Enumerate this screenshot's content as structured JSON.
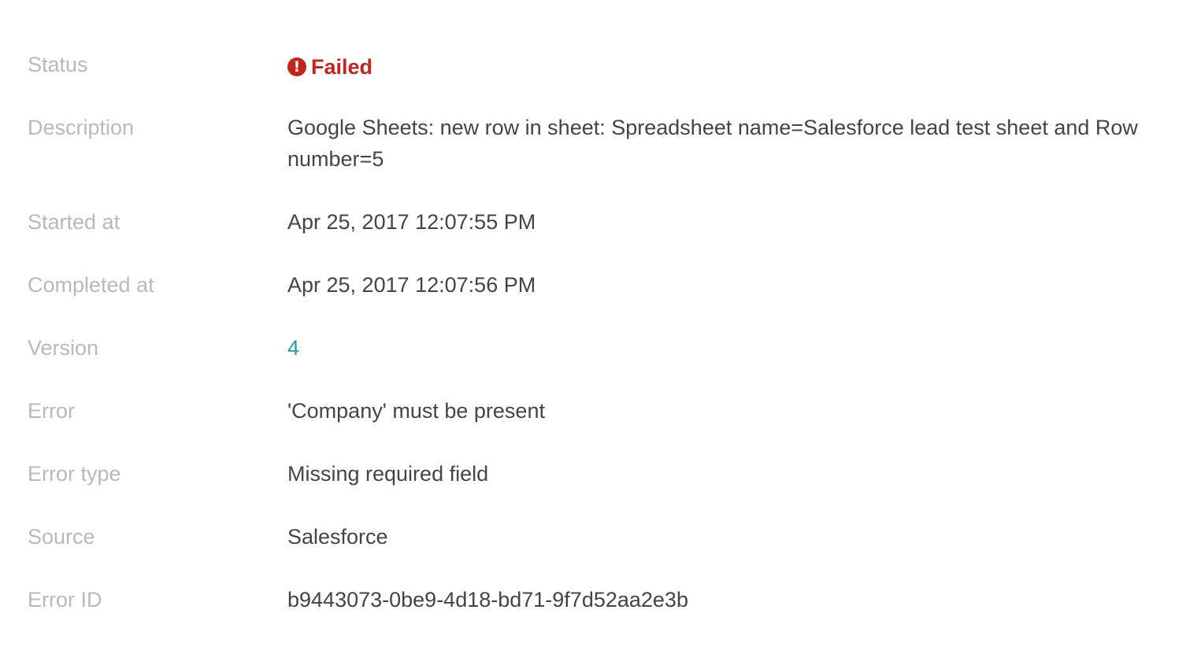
{
  "details": {
    "status": {
      "label": "Status",
      "value": "Failed",
      "icon": "exclamation-circle-icon",
      "color": "#c0271c"
    },
    "description": {
      "label": "Description",
      "value": "Google Sheets: new row in sheet: Spreadsheet name=Salesforce lead test sheet and Row number=5"
    },
    "started_at": {
      "label": "Started at",
      "value": "Apr 25, 2017 12:07:55 PM"
    },
    "completed_at": {
      "label": "Completed at",
      "value": "Apr 25, 2017 12:07:56 PM"
    },
    "version": {
      "label": "Version",
      "value": "4",
      "color": "#2b9aa0"
    },
    "error": {
      "label": "Error",
      "value": "'Company' must be present"
    },
    "error_type": {
      "label": "Error type",
      "value": "Missing required field"
    },
    "source": {
      "label": "Source",
      "value": "Salesforce"
    },
    "error_id": {
      "label": "Error ID",
      "value": "b9443073-0be9-4d18-bd71-9f7d52aa2e3b"
    }
  }
}
